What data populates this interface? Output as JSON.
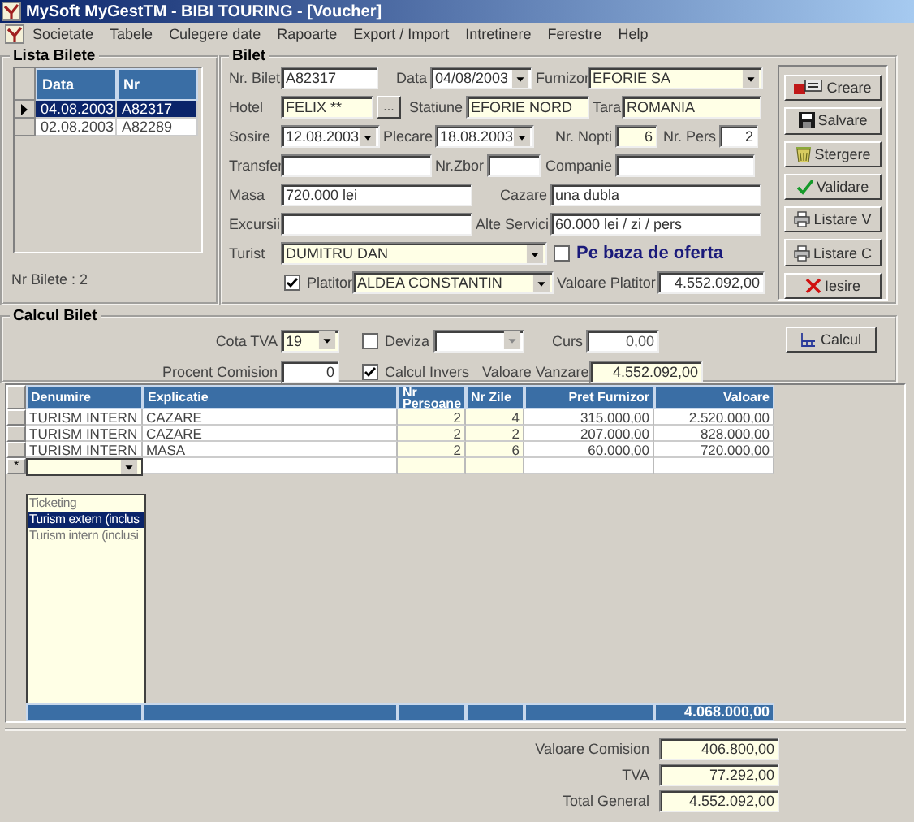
{
  "window": {
    "title": "MySoft MyGestTM  - BIBI TOURING - [Voucher]"
  },
  "menu": [
    "Societate",
    "Tabele",
    "Culegere date",
    "Rapoarte",
    "Export / Import",
    "Intretinere",
    "Ferestre",
    "Help"
  ],
  "lista_bilete": {
    "title": "Lista Bilete",
    "columns": [
      "Data",
      "Nr"
    ],
    "rows": [
      {
        "cells": [
          "04.08.2003",
          "A82317"
        ],
        "selected": true
      },
      {
        "cells": [
          "02.08.2003",
          "A82289"
        ],
        "selected": false
      }
    ],
    "count": "Nr Bilete :  2"
  },
  "bilet": {
    "title": "Bilet",
    "nr_bilet": {
      "label": "Nr. Bilet",
      "value": "A82317"
    },
    "data": {
      "label": "Data",
      "value": "04/08/2003"
    },
    "furnizor": {
      "label": "Furnizor",
      "value": "EFORIE SA"
    },
    "hotel": {
      "label": "Hotel",
      "value": "FELIX **",
      "button": "..."
    },
    "statiune": {
      "label": "Statiune",
      "value": "EFORIE NORD"
    },
    "tara": {
      "label": "Tara",
      "value": "ROMANIA"
    },
    "sosire": {
      "label": "Sosire",
      "value": "12.08.2003"
    },
    "plecare": {
      "label": "Plecare",
      "value": "18.08.2003"
    },
    "nr_nopti": {
      "label": "Nr. Nopti",
      "value": "6"
    },
    "nr_pers": {
      "label": "Nr. Pers",
      "value": "2"
    },
    "transfer": {
      "label": "Transfer"
    },
    "nr_zbor": {
      "label": "Nr.Zbor"
    },
    "companie": {
      "label": "Companie"
    },
    "masa": {
      "label": "Masa",
      "value": "720.000 lei"
    },
    "cazare": {
      "label": "Cazare",
      "value": "una dubla"
    },
    "excursii": {
      "label": "Excursii"
    },
    "alte_servicii": {
      "label": "Alte Servicii",
      "value": "60.000 lei / zi / pers"
    },
    "turist": {
      "label": "Turist",
      "value": "DUMITRU DAN"
    },
    "pe_baza_de_oferta": {
      "label": "Pe baza de oferta",
      "checked": false
    },
    "platitor": {
      "label": "Platitor",
      "checked": true,
      "value": "ALDEA CONSTANTIN"
    },
    "valoare_platitor": {
      "label": "Valoare Platitor",
      "value": "4.552.092,00"
    }
  },
  "buttons": [
    "Creare",
    "Salvare",
    "Stergere",
    "Validare",
    "Listare V",
    "Listare C",
    "Iesire"
  ],
  "calcul_bilet": {
    "title": "Calcul Bilet",
    "cota_tva": {
      "label": "Cota TVA",
      "value": "19"
    },
    "deviza": {
      "label": "Deviza",
      "checked": false
    },
    "curs": {
      "label": "Curs",
      "value": "0,00"
    },
    "procent_comision": {
      "label": "Procent Comision",
      "value": "0"
    },
    "calcul_invers": {
      "label": "Calcul Invers",
      "checked": true
    },
    "valoare_vanzare": {
      "label": "Valoare Vanzare",
      "value": "4.552.092,00"
    },
    "calcul_button": "Calcul"
  },
  "table": {
    "columns": [
      "Denumire",
      "Explicatie",
      "Nr Persoane",
      "Nr Zile",
      "Pret Furnizor",
      "Valoare"
    ],
    "rows": [
      [
        "TURISM INTERN",
        "CAZARE",
        "2",
        "4",
        "315.000,00",
        "2.520.000,00"
      ],
      [
        "TURISM INTERN",
        "CAZARE",
        "2",
        "2",
        "207.000,00",
        "828.000,00"
      ],
      [
        "TURISM INTERN",
        "MASA",
        "2",
        "6",
        "60.000,00",
        "720.000,00"
      ]
    ],
    "new_row_marker": "*",
    "dropdown": [
      {
        "label": "Ticketing",
        "selected": false
      },
      {
        "label": "Turism extern (inclus",
        "selected": true
      },
      {
        "label": "Turism intern (inclusi",
        "selected": false
      }
    ],
    "total": "4.068.000,00"
  },
  "totals": [
    {
      "label": "Valoare Comision",
      "value": "406.800,00"
    },
    {
      "label": "TVA",
      "value": "77.292,00"
    },
    {
      "label": "Total General",
      "value": "4.552.092,00"
    }
  ]
}
